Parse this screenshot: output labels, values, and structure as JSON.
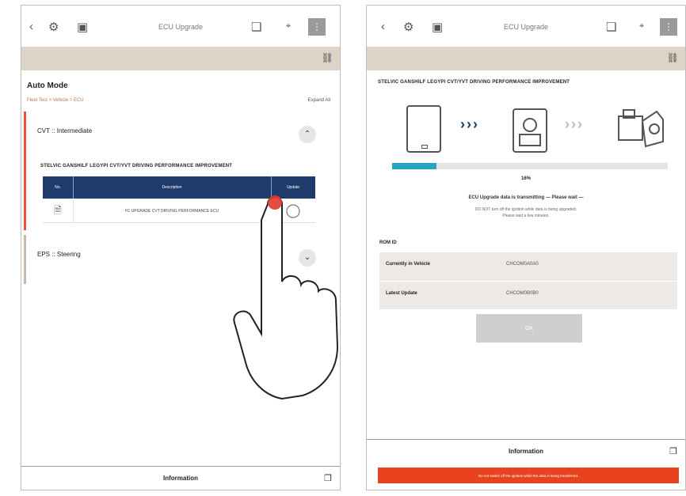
{
  "left": {
    "header_title": "ECU Upgrade",
    "page_title": "Auto Mode",
    "breadcrumb": "Fleet Test > Vehicle > ECU",
    "expand_all": "Expand All",
    "section_cvt": {
      "title": "CVT :: Intermediate"
    },
    "update_title": "STELVIC GANSHILF LEGYPI CVT/YVT DRIVING PERFORMANCE IMPROVEMENT",
    "table": {
      "headers": [
        "No.",
        "Description",
        "Update"
      ],
      "rows": [
        {
          "description": "H1 UPGRADE CVT DRIVING PERFORMANCE ECU"
        }
      ]
    },
    "section_eps": {
      "title": "EPS :: Steering"
    },
    "info_label": "Information"
  },
  "right": {
    "header_title": "ECU Upgrade",
    "update_title": "STELVIC GANSHILF LEGYPI CVT/YVT DRIVING PERFORMANCE IMPROVEMENT",
    "progress_percent": 16,
    "progress_text": "16%",
    "status_main": "ECU Upgrade data is transmitting — Please wait —",
    "status_sub_1": "DO NOT turn off the ignition while data is being upgraded.",
    "status_sub_2": "Please wait a few minutes.",
    "section_label": "ROM ID",
    "rows": [
      {
        "label": "Currently in Vehicle",
        "value": "CHCOM0A0A0"
      },
      {
        "label": "Latest Update",
        "value": "CHCOM0B0B0"
      }
    ],
    "ok_label": "OK",
    "info_label": "Information",
    "alert_text": "Do not switch off the ignition while the data is being transferred."
  },
  "colors": {
    "accent_red": "#e4542f",
    "table_header": "#1f3b6c",
    "progress": "#2aa3c2",
    "band": "#ddd3c7",
    "alert": "#e8431e"
  },
  "icons": [
    "back-icon",
    "settings-icon",
    "vehicle-icon",
    "copy-icon",
    "fullscreen-icon",
    "menu-icon",
    "car-icon",
    "document-icon",
    "touch-hand-icon",
    "export-icon"
  ]
}
